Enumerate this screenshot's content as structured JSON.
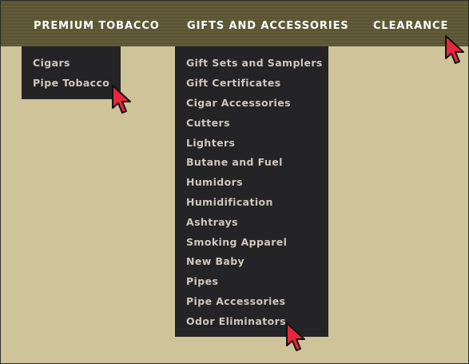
{
  "nav": {
    "items": [
      {
        "label": "PREMIUM TOBACCO"
      },
      {
        "label": "GIFTS AND ACCESSORIES"
      },
      {
        "label": "CLEARANCE"
      }
    ]
  },
  "dropdown_tobacco": {
    "items": [
      "Cigars",
      "Pipe Tobacco"
    ]
  },
  "dropdown_gifts": {
    "items": [
      "Gift Sets and Samplers",
      "Gift Certificates",
      "Cigar Accessories",
      "Cutters",
      "Lighters",
      "Butane and Fuel",
      "Humidors",
      "Humidification",
      "Ashtrays",
      "Smoking Apparel",
      "New Baby",
      "Pipes",
      "Pipe Accessories",
      "Odor Eliminators"
    ]
  },
  "colors": {
    "navbar": "#5e5837",
    "page_bg": "#cfc39a",
    "dropdown_bg": "#242325",
    "cursor": "#e8263c"
  },
  "icons": [
    "cursor-arrow-icon"
  ]
}
